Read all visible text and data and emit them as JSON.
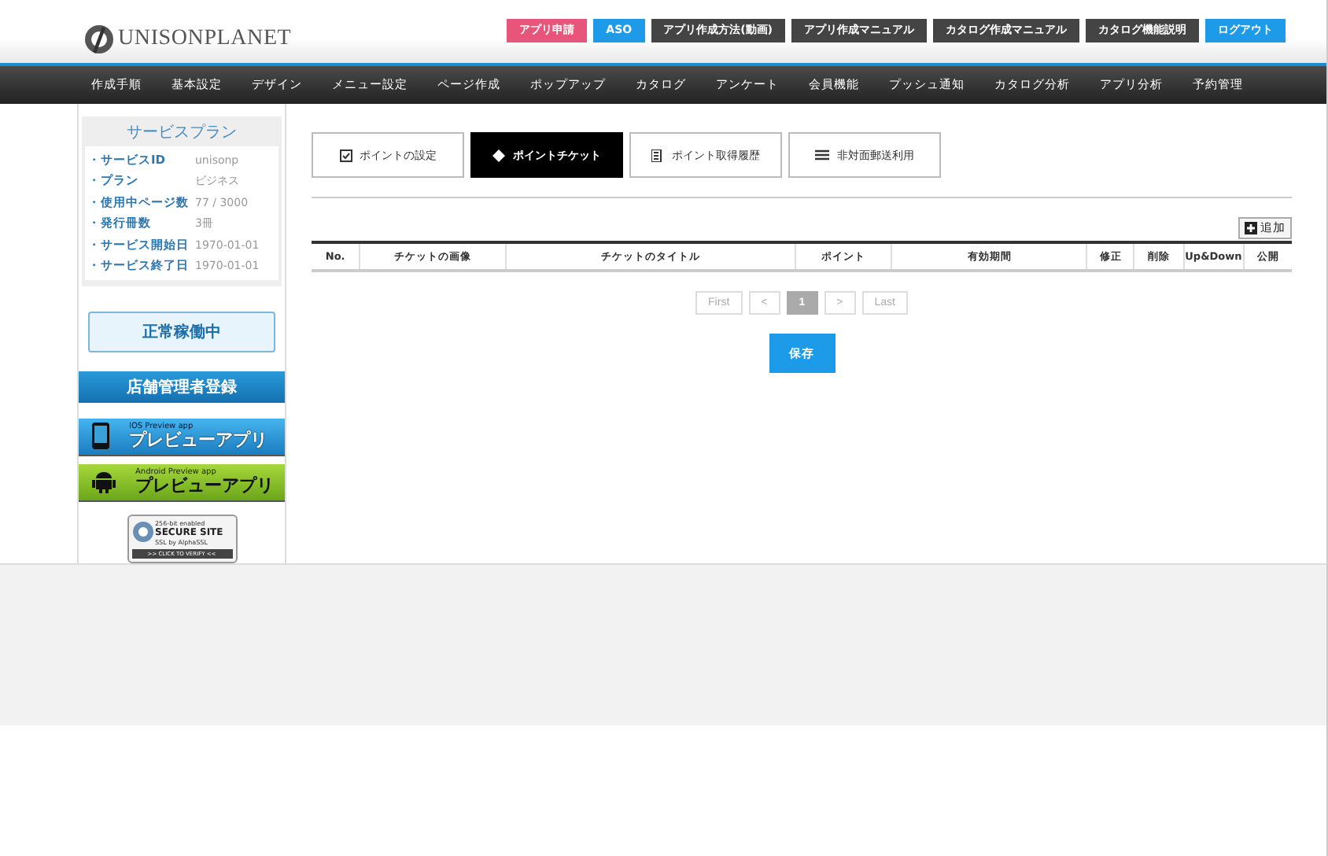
{
  "header": {
    "logo": "UNISONPLANET",
    "links": [
      {
        "label": "アプリ申請",
        "color": "#e8557a"
      },
      {
        "label": "ASO",
        "color": "#1e9be8"
      },
      {
        "label": "アプリ作成方法(動画)",
        "color": "#444444"
      },
      {
        "label": "アプリ作成マニュアル",
        "color": "#444444"
      },
      {
        "label": "カタログ作成マニュアル",
        "color": "#444444"
      },
      {
        "label": "カタログ機能説明",
        "color": "#444444"
      },
      {
        "label": "ログアウト",
        "color": "#1e9be8"
      }
    ]
  },
  "nav": [
    "作成手順",
    "基本設定",
    "デザイン",
    "メニュー設定",
    "ページ作成",
    "ポップアップ",
    "カタログ",
    "アンケート",
    "会員機能",
    "プッシュ通知",
    "カタログ分析",
    "アプリ分析",
    "予約管理"
  ],
  "sidebar": {
    "plan": {
      "title": "サービスプラン",
      "rows": [
        {
          "label": "・サービスID",
          "value": "unisonp"
        },
        {
          "label": "・プラン",
          "value": "ビジネス"
        },
        {
          "label": "・使用中ページ数",
          "value": "77 / 3000"
        },
        {
          "label": "・発行冊数",
          "value": "3冊"
        },
        {
          "label": "・サービス開始日",
          "value": "1970-01-01"
        },
        {
          "label": "・サービス終了日",
          "value": "1970-01-01"
        }
      ]
    },
    "status": "正常稼働中",
    "manager": "店舗管理者登録",
    "apps": [
      {
        "kind": "ios",
        "small": "IOS Preview app",
        "label": "プレビューアプリ"
      },
      {
        "kind": "android",
        "small": "Android Preview app",
        "label": "プレビューアプリ"
      }
    ],
    "ssl": {
      "line_1": "256-bit enabled",
      "line_2": "SECURE SITE",
      "line_3": "SSL by AlphaSSL",
      "line_4": ">> CLICK TO VERIFY <<"
    }
  },
  "tabs": [
    {
      "label": "ポイントの設定",
      "selected": false
    },
    {
      "label": "ポイントチケット",
      "selected": true
    },
    {
      "label": "ポイント取得履歴",
      "selected": false
    },
    {
      "label": "非対面郵送利用",
      "selected": false
    }
  ],
  "add_button": "追加",
  "table": {
    "columns": [
      "No.",
      "チケットの画像",
      "チケットのタイトル",
      "ポイント",
      "有効期間",
      "修正",
      "削除",
      "Up&Down",
      "公開"
    ]
  },
  "pagination": [
    {
      "label": "First",
      "selected": false
    },
    {
      "label": "<",
      "selected": false
    },
    {
      "label": "1",
      "selected": true
    },
    {
      "label": ">",
      "selected": false
    },
    {
      "label": "Last",
      "selected": false
    }
  ],
  "save_button": "保存"
}
